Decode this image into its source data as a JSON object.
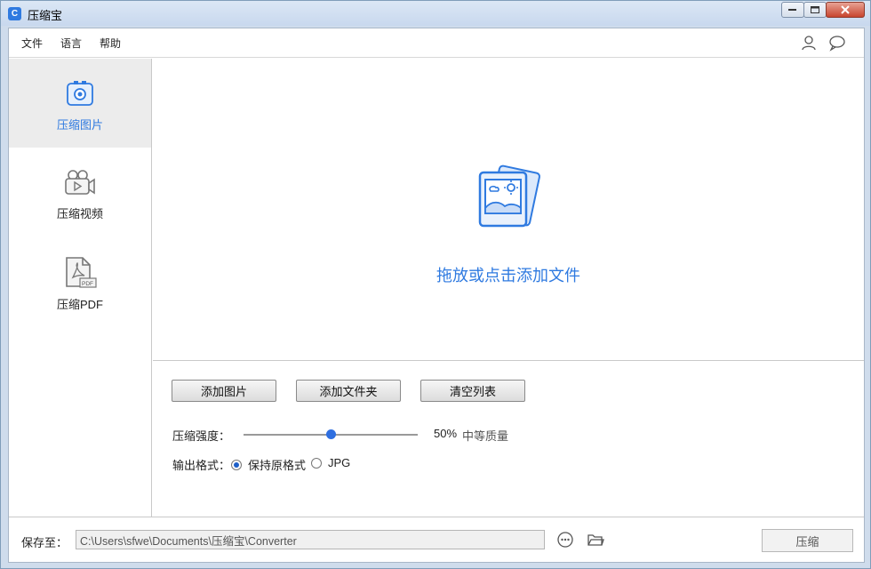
{
  "window": {
    "title": "压缩宝",
    "app_icon": "C"
  },
  "menu": {
    "file": "文件",
    "language": "语言",
    "help": "帮助",
    "icons": [
      "user-icon",
      "chat-icon"
    ]
  },
  "sidebar": {
    "items": [
      {
        "label": "压缩图片",
        "icon": "image-compress-icon",
        "active": true
      },
      {
        "label": "压缩视频",
        "icon": "video-compress-icon",
        "active": false
      },
      {
        "label": "压缩PDF",
        "icon": "pdf-compress-icon",
        "active": false
      }
    ]
  },
  "dropzone": {
    "text": "拖放或点击添加文件",
    "icon": "image-stack-icon"
  },
  "buttons": {
    "add_images": "添加图片",
    "add_folder": "添加文件夹",
    "clear_list": "清空列表"
  },
  "compression": {
    "label": "压缩强度：",
    "value_text": "50%",
    "value": 50,
    "quality": "中等质量"
  },
  "output": {
    "label": "输出格式：",
    "options": [
      {
        "label": "保持原格式",
        "selected": true
      },
      {
        "label": "JPG",
        "selected": false
      }
    ]
  },
  "save": {
    "label": "保存至：",
    "path": "C:\\Users\\sfwe\\Documents\\压缩宝\\Converter",
    "compress_button": "压缩"
  },
  "colors": {
    "accent": "#2f7ae0",
    "active_bg": "#ececec"
  }
}
